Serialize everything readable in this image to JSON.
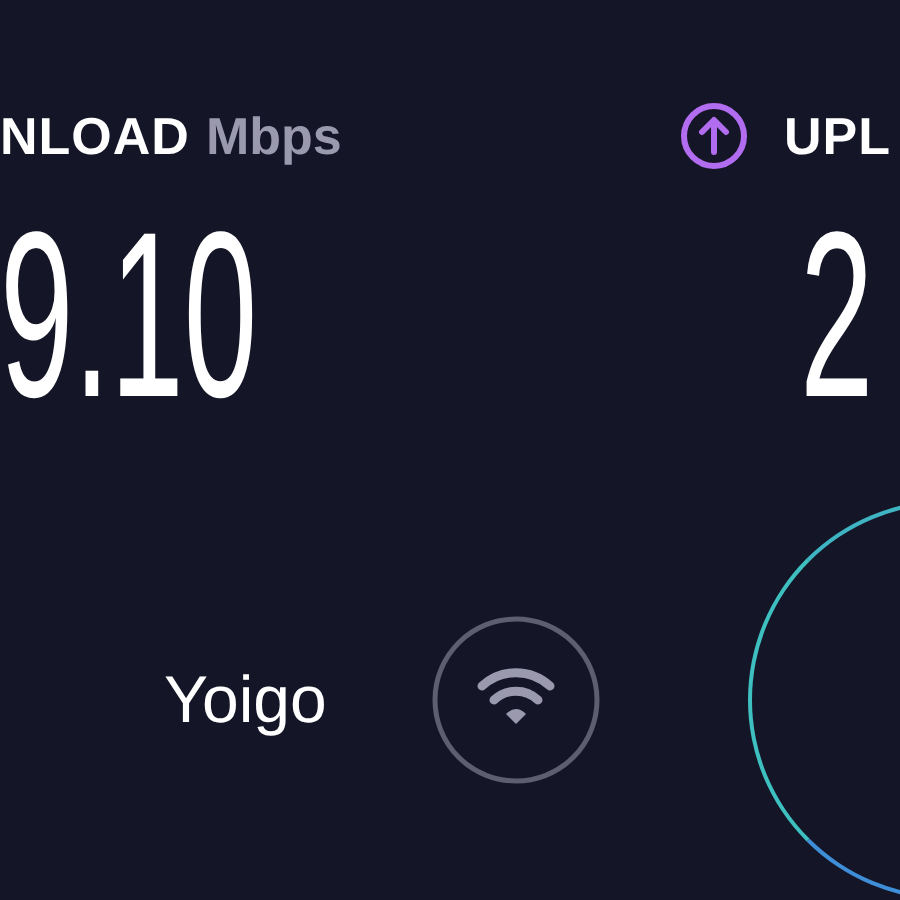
{
  "download": {
    "label": "NLOAD",
    "unit": "Mbps",
    "value": "9.10"
  },
  "upload": {
    "label": "UPL",
    "value": "2"
  },
  "isp": {
    "name": "Yoigo"
  }
}
